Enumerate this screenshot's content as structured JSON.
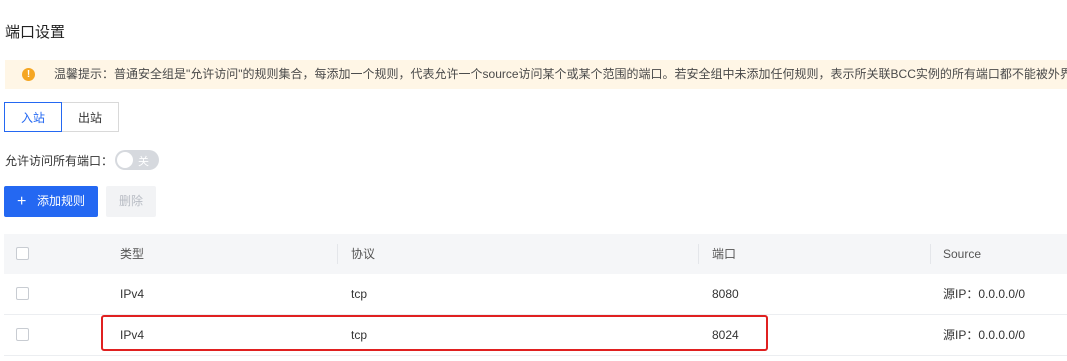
{
  "page": {
    "title": "端口设置"
  },
  "notice": {
    "icon": "warning-icon",
    "text": "温馨提示：普通安全组是\"允许访问\"的规则集合，每添加一个规则，代表允许一个source访问某个或某个范围的端口。若安全组中未添加任何规则，表示所关联BCC实例的所有端口都不能被外界访问。"
  },
  "tabs": [
    {
      "label": "入站",
      "active": true
    },
    {
      "label": "出站",
      "active": false
    }
  ],
  "allow_all": {
    "label": "允许访问所有端口：",
    "toggle_text": "关",
    "on": false
  },
  "actions": {
    "add_label": "添加规则",
    "add_icon": "+",
    "delete_label": "删除"
  },
  "table": {
    "headers": {
      "type": "类型",
      "protocol": "协议",
      "port": "端口",
      "source": "Source"
    },
    "rows": [
      {
        "type": "IPv4",
        "protocol": "tcp",
        "port": "8080",
        "source": "源IP：0.0.0.0/0"
      },
      {
        "type": "IPv4",
        "protocol": "tcp",
        "port": "8024",
        "source": "源IP：0.0.0.0/0",
        "highlighted": true
      }
    ]
  },
  "colors": {
    "primary": "#2468f2",
    "warning": "#f5a623",
    "highlight": "#e02020"
  }
}
